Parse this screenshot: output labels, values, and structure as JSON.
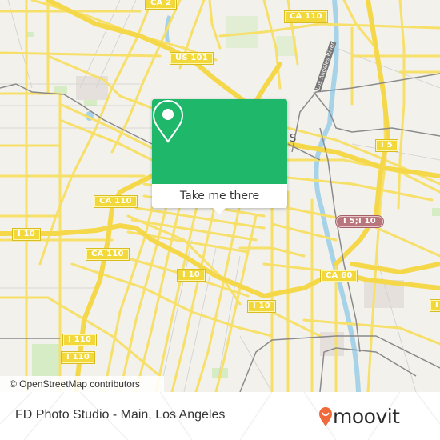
{
  "map": {
    "attribution": "© OpenStreetMap contributors",
    "shields": [
      {
        "label": "CA 2",
        "style": "yellow"
      },
      {
        "label": "US 101",
        "style": "yellow"
      },
      {
        "label": "CA 110",
        "style": "yellow"
      },
      {
        "label": "I 5",
        "style": "yellow"
      },
      {
        "label": "CA 110",
        "style": "yellow"
      },
      {
        "label": "I 10",
        "style": "yellow"
      },
      {
        "label": "CA 110",
        "style": "yellow"
      },
      {
        "label": "I 10",
        "style": "yellow"
      },
      {
        "label": "I 5;I 10",
        "style": "red"
      },
      {
        "label": "CA 60",
        "style": "yellow"
      },
      {
        "label": "I 10",
        "style": "yellow"
      },
      {
        "label": "I 110",
        "style": "yellow"
      },
      {
        "label": "I 110",
        "style": "yellow"
      },
      {
        "label": "I",
        "style": "yellow"
      }
    ],
    "river_label": "Los Angeles River",
    "partial_label": "S",
    "colors": {
      "background": "#f2f1ec",
      "road": "#f7e06a",
      "water": "#a7d3e8",
      "rail": "#8a8a8a",
      "park": "#d6ecc4"
    }
  },
  "popup": {
    "icon": "map-pin-icon",
    "button_label": "Take me there",
    "color": "#1fb76a"
  },
  "footer": {
    "place_name": "FD Photo Studio - Main, Los Angeles",
    "brand": "moovit",
    "brand_color": "#f06a3b"
  }
}
